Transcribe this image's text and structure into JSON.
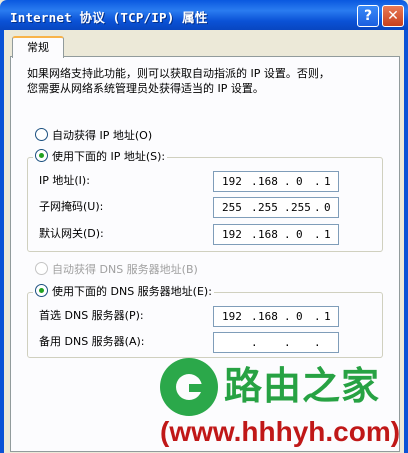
{
  "window": {
    "title": "Internet 协议 (TCP/IP) 属性",
    "help_btn": "?",
    "close_btn": "✕"
  },
  "tab": {
    "label": "常规"
  },
  "intro": "如果网络支持此功能，则可以获取自动指派的 IP 设置。否则，\n您需要从网络系统管理员处获得适当的 IP 设置。",
  "ip_section": {
    "auto_label": "自动获得 IP 地址(O)",
    "manual_label": "使用下面的 IP 地址(S):",
    "selected": "manual",
    "fields": [
      {
        "label": "IP 地址(I):",
        "octets": [
          "192",
          "168",
          "0",
          "1"
        ]
      },
      {
        "label": "子网掩码(U):",
        "octets": [
          "255",
          "255",
          "255",
          "0"
        ]
      },
      {
        "label": "默认网关(D):",
        "octets": [
          "192",
          "168",
          "0",
          "1"
        ]
      }
    ]
  },
  "dns_section": {
    "auto_label": "自动获得 DNS 服务器地址(B)",
    "auto_disabled": true,
    "manual_label": "使用下面的 DNS 服务器地址(E):",
    "selected": "manual",
    "fields": [
      {
        "label": "首选 DNS 服务器(P):",
        "octets": [
          "192",
          "168",
          "0",
          "1"
        ]
      },
      {
        "label": "备用 DNS 服务器(A):",
        "octets": [
          "",
          "",
          "",
          ""
        ]
      }
    ]
  },
  "watermark": {
    "name": "路由之家",
    "url": "(www.hhhyh.com)",
    "color_green": "#27a243",
    "color_red": "#c01818"
  }
}
